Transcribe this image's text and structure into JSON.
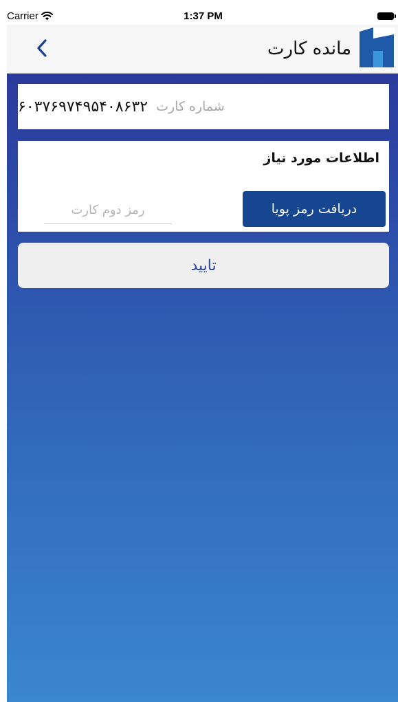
{
  "status_bar": {
    "carrier": "Carrier",
    "time": "1:37 PM",
    "icons": [
      "wifi-icon",
      "battery-icon"
    ]
  },
  "nav": {
    "title": "مانده کارت",
    "back_icon": "chevron-left-icon",
    "logo": "bank-saderat-logo"
  },
  "card": {
    "label": "شماره کارت",
    "number": "۶۰۳۷۶۹۷۴۹۵۴۰۸۶۳۲"
  },
  "info_panel": {
    "title": "اطلاعات مورد نیاز",
    "dynamic_password_button": "دریافت رمز پویا",
    "second_password_placeholder": "رمز دوم کارت",
    "second_password_value": ""
  },
  "confirm_button": "تایید",
  "colors": {
    "primary_button": "#15468f",
    "gradient_top": "#2a3a9c",
    "gradient_bottom": "#3a86cf",
    "accent_text": "#2b4ba3",
    "logo_blue": "#1e5aa8"
  }
}
